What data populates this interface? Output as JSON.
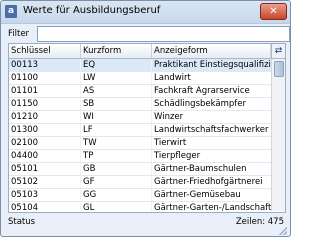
{
  "window": {
    "title": "Werte für Ausbildungsberuf",
    "icon_name": "table-icon",
    "close_label": "✕"
  },
  "filter": {
    "label": "Filter",
    "value": ""
  },
  "grid": {
    "columns": [
      "Schlüssel",
      "Kurzform",
      "Anzeigeform"
    ],
    "column_chooser_icon": "column-chooser-icon",
    "rows": [
      [
        "00113",
        "EQ",
        "Praktikant Einstiegsqualifizieru..."
      ],
      [
        "01100",
        "LW",
        "Landwirt"
      ],
      [
        "01101",
        "AS",
        "Fachkraft Agrarservice"
      ],
      [
        "01150",
        "SB",
        "Schädlingsbekämpfer"
      ],
      [
        "01210",
        "WI",
        "Winzer"
      ],
      [
        "01300",
        "LF",
        "Landwirtschaftsfachwerker"
      ],
      [
        "02100",
        "TW",
        "Tierwirt"
      ],
      [
        "04400",
        "TP",
        "Tierpfleger"
      ],
      [
        "05101",
        "GB",
        "Gärtner-Baumschulen"
      ],
      [
        "05102",
        "GF",
        "Gärtner-Friedhofgärtnerei"
      ],
      [
        "05103",
        "GG",
        "Gärtner-Gemüsebau"
      ],
      [
        "05104",
        "GL",
        "Gärtner-Garten-/Landschaftsbau"
      ]
    ]
  },
  "status": {
    "label": "Status",
    "count_text": "Zeilen: 475"
  }
}
